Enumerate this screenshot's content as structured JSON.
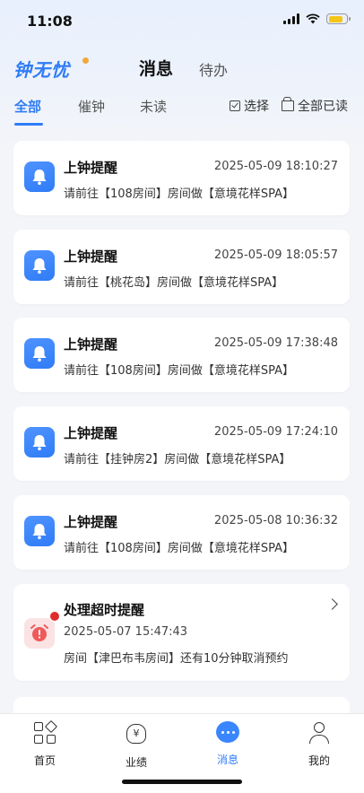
{
  "status_bar": {
    "time": "11:08"
  },
  "app": {
    "logo": "钟无忧"
  },
  "header_tabs": [
    {
      "label": "消息",
      "active": true
    },
    {
      "label": "待办",
      "active": false
    }
  ],
  "filter_tabs": [
    {
      "label": "全部",
      "active": true
    },
    {
      "label": "催钟",
      "active": false
    },
    {
      "label": "未读",
      "active": false
    }
  ],
  "actions": {
    "select": "选择",
    "read_all": "全部已读"
  },
  "messages": [
    {
      "title": "上钟提醒",
      "time": "2025-05-09 18:10:27",
      "body": "请前往【108房间】房间做【意境花样SPA】"
    },
    {
      "title": "上钟提醒",
      "time": "2025-05-09 18:05:57",
      "body": "请前往【桃花岛】房间做【意境花样SPA】"
    },
    {
      "title": "上钟提醒",
      "time": "2025-05-09 17:38:48",
      "body": "请前往【108房间】房间做【意境花样SPA】"
    },
    {
      "title": "上钟提醒",
      "time": "2025-05-09 17:24:10",
      "body": "请前往【挂钟房2】房间做【意境花样SPA】"
    },
    {
      "title": "上钟提醒",
      "time": "2025-05-08 10:36:32",
      "body": "请前往【108房间】房间做【意境花样SPA】"
    }
  ],
  "overtime_message": {
    "title": "处理超时提醒",
    "time": "2025-05-07 15:47:43",
    "body": "房间【津巴布韦房间】还有10分钟取消预约"
  },
  "tabbar": [
    {
      "label": "首页",
      "icon": "home-grid-icon",
      "active": false
    },
    {
      "label": "业绩",
      "icon": "money-bag-icon",
      "active": false
    },
    {
      "label": "消息",
      "icon": "chat-icon",
      "active": true
    },
    {
      "label": "我的",
      "icon": "person-icon",
      "active": false
    }
  ],
  "colors": {
    "accent": "#2f7cf6",
    "alert": "#e02b2b",
    "background": "#f4f5f8"
  }
}
